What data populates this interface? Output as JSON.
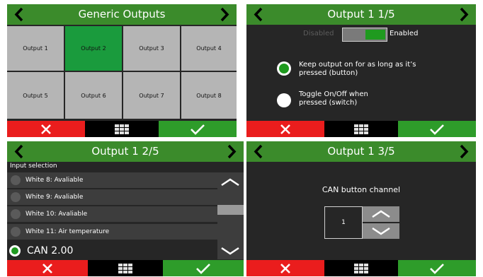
{
  "colors": {
    "header": "#3b8b2b",
    "selected": "#1a9b3d",
    "cancel": "#ea1d1d",
    "confirm": "#2e9c2a"
  },
  "panel1": {
    "title": "Generic Outputs",
    "outputs": [
      "Output 1",
      "Output 2",
      "Output 3",
      "Output 4",
      "Output 5",
      "Output 6",
      "Output 7",
      "Output 8"
    ],
    "selected": "Output 2"
  },
  "panel2": {
    "title": "Output 1 1/5",
    "disabled_label": "Disabled",
    "enabled_label": "Enabled",
    "option1": "Keep output on for as long as it’s pressed (button)",
    "option2": "Toggle On/Off when pressed (switch)"
  },
  "panel3": {
    "title": "Output 1 2/5",
    "section_label": "Input selection",
    "items": [
      "White 8: Avaliable",
      "White 9: Avaliable",
      "White 10: Avaliable",
      "White 11: Air temperature"
    ],
    "selected_item": "CAN 2.00"
  },
  "panel4": {
    "title": "Output 1 3/5",
    "label": "CAN button channel",
    "channel_value": "1"
  },
  "icons": {
    "prev": "chevron-left-icon",
    "next": "chevron-right-icon",
    "cancel": "x-icon",
    "menu": "grid-icon",
    "confirm": "check-icon",
    "up": "chevron-up-icon",
    "down": "chevron-down-icon"
  }
}
